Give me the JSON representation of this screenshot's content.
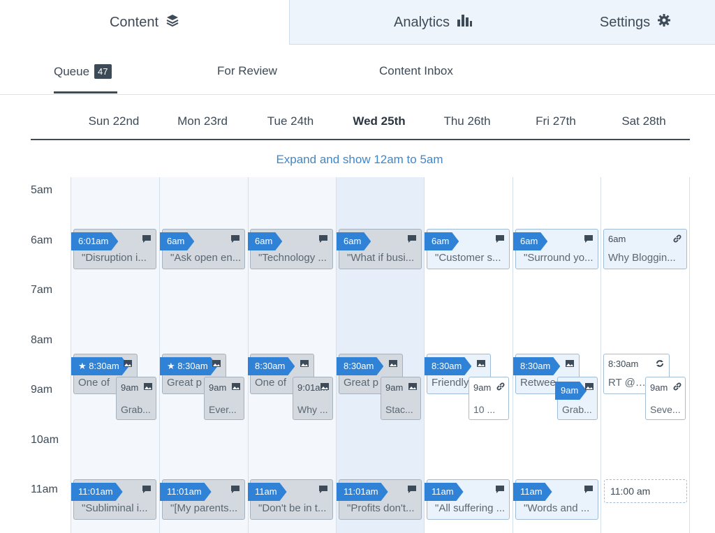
{
  "top_tabs": {
    "content": {
      "label": "Content",
      "icon": "layers-icon"
    },
    "analytics": {
      "label": "Analytics",
      "icon": "bar-chart-icon"
    },
    "settings": {
      "label": "Settings",
      "icon": "gear-icon"
    }
  },
  "sub_tabs": {
    "queue": {
      "label": "Queue",
      "count": "47"
    },
    "review": {
      "label": "For Review"
    },
    "inbox": {
      "label": "Content Inbox"
    }
  },
  "days": [
    "Sun 22nd",
    "Mon 23rd",
    "Tue 24th",
    "Wed 25th",
    "Thu 26th",
    "Fri 27th",
    "Sat 28th"
  ],
  "today_index": 3,
  "expand_label": "Expand and show 12am to 5am",
  "hours": [
    "5am",
    "6am",
    "7am",
    "8am",
    "9am",
    "10am",
    "11am"
  ],
  "posts_6am": [
    {
      "time": "6:01am",
      "text": "\"Disruption i...",
      "icon": "comment-icon"
    },
    {
      "time": "6am",
      "text": "\"Ask open en...",
      "icon": "comment-icon"
    },
    {
      "time": "6am",
      "text": "\"Technology ...",
      "icon": "comment-icon"
    },
    {
      "time": "6am",
      "text": "\"What if busi...",
      "icon": "comment-icon"
    },
    {
      "time": "6am",
      "text": "\"Customer s...",
      "icon": "comment-icon"
    },
    {
      "time": "6am",
      "text": "\"Surround yo...",
      "icon": "comment-icon"
    },
    {
      "time": "6am",
      "text": "Why Bloggin...",
      "icon": "link-icon"
    }
  ],
  "posts_830": [
    {
      "time": "8:30am",
      "star": true,
      "text": "One of",
      "icon": "image-icon"
    },
    {
      "time": "8:30am",
      "star": true,
      "text": "Great p",
      "icon": "image-icon"
    },
    {
      "time": "8:30am",
      "star": false,
      "text": "One of",
      "icon": "image-icon"
    },
    {
      "time": "8:30am",
      "star": false,
      "text": "Great p",
      "icon": "image-icon"
    },
    {
      "time": "8:30am",
      "star": false,
      "text": "Friendly",
      "icon": "image-icon"
    },
    {
      "time": "8:30am",
      "star": false,
      "text": "Retwee",
      "icon": "image-icon"
    },
    {
      "time": "8:30am",
      "star": false,
      "text": "RT @Hu",
      "icon": "repeat-icon"
    }
  ],
  "posts_9am": [
    {
      "time": "9am",
      "text": "Grab...",
      "icon": "image-icon"
    },
    {
      "time": "9am",
      "text": "Ever...",
      "icon": "image-icon"
    },
    {
      "time": "9:01am",
      "text": "Why ...",
      "icon": "image-icon"
    },
    {
      "time": "9am",
      "text": "Stac...",
      "icon": "image-icon"
    },
    {
      "time": "9am",
      "text": "10 ...",
      "icon": "link-icon"
    },
    {
      "time": "9am",
      "text": "Grab...",
      "icon": "image-icon"
    },
    {
      "time": "9am",
      "text": "Seve...",
      "icon": "link-icon"
    }
  ],
  "posts_11am": [
    {
      "time": "11:01am",
      "text": "\"Subliminal i...",
      "icon": "comment-icon"
    },
    {
      "time": "11:01am",
      "text": "\"[My parents...",
      "icon": "comment-icon"
    },
    {
      "time": "11am",
      "text": "\"Don't be in t...",
      "icon": "comment-icon"
    },
    {
      "time": "11:01am",
      "text": "\"Profits don't...",
      "icon": "comment-icon"
    },
    {
      "time": "11am",
      "text": "\"All suffering ...",
      "icon": "comment-icon"
    },
    {
      "time": "11am",
      "text": "\"Words and ...",
      "icon": "comment-icon"
    }
  ],
  "empty_slot_label": "11:00 am",
  "colors": {
    "accent": "#2f82d6",
    "link": "#3f87c9",
    "text": "#3d4a57"
  }
}
